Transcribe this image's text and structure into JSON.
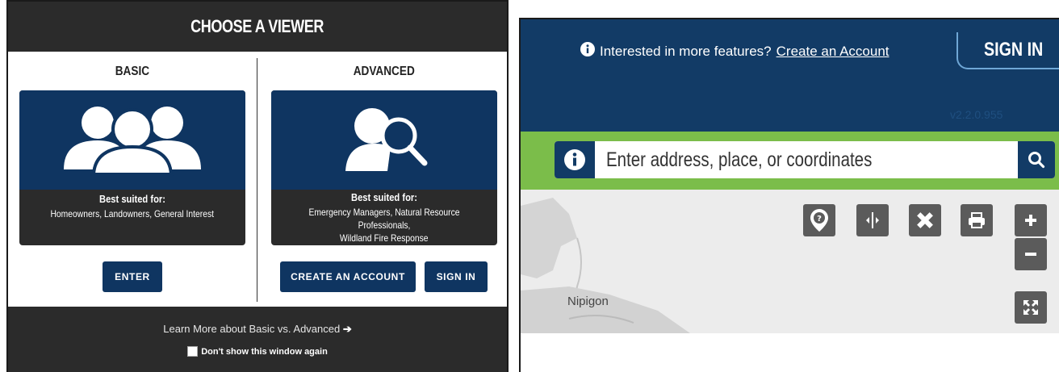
{
  "chooser": {
    "title": "CHOOSE A VIEWER",
    "basic": {
      "title": "BASIC",
      "icon": "users-icon",
      "best_label": "Best suited for:",
      "best_text": "Homeowners, Landowners, General Interest",
      "enter_label": "ENTER"
    },
    "advanced": {
      "title": "ADVANCED",
      "icon": "user-search-icon",
      "best_label": "Best suited for:",
      "best_text_line1": "Emergency Managers, Natural Resource Professionals,",
      "best_text_line2": "Wildland Fire Response",
      "create_label": "CREATE AN ACCOUNT",
      "signin_label": "SIGN IN"
    },
    "learn_more": "Learn More about Basic vs. Advanced",
    "dont_show": "Don't show this window again"
  },
  "viewer": {
    "notice_text": "Interested in more features?",
    "notice_link": "Create an Account",
    "signin_label": "SIGN IN",
    "version": "v2.2.0.955",
    "search_placeholder": "Enter address, place, or coordinates",
    "map_label": "Nipigon",
    "tools": [
      "help-pin-icon",
      "swipe-icon",
      "measure-icon",
      "print-icon",
      "zoom-in-icon",
      "zoom-out-icon",
      "fullscreen-icon"
    ]
  },
  "colors": {
    "navy": "#0f3561",
    "dark": "#2b2b2b",
    "green": "#7bbd4a",
    "topbar": "#123b66"
  }
}
